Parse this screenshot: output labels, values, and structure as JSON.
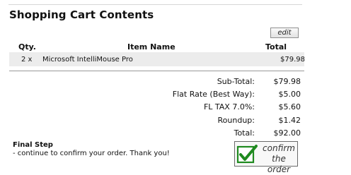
{
  "cart": {
    "heading": "Shopping Cart Contents",
    "edit_label": "edit",
    "columns": {
      "qty": "Qty.",
      "name": "Item Name",
      "total": "Total"
    },
    "items": [
      {
        "qty": "2 x",
        "name": "Microsoft IntelliMouse Pro",
        "price": "$79.98"
      }
    ]
  },
  "totals": [
    {
      "label": "Sub-Total:",
      "value": "$79.98"
    },
    {
      "label": "Flat Rate (Best Way):",
      "value": "$5.00"
    },
    {
      "label": "FL TAX 7.0%:",
      "value": "$5.60"
    },
    {
      "label": "Roundup:",
      "value": "$1.42"
    },
    {
      "label": "Total:",
      "value": "$92.00"
    }
  ],
  "final_step": {
    "title": "Final Step",
    "text": "- continue to confirm your order. Thank you!"
  },
  "confirm_button": {
    "line1": "confirm",
    "line2": "the order",
    "icon": "checkmark-icon",
    "check_color": "#1f8a1f"
  }
}
